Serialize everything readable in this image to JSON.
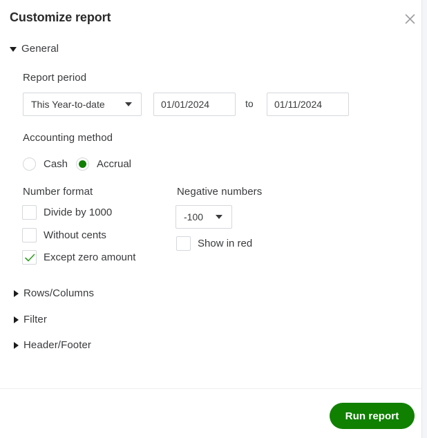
{
  "panel": {
    "title": "Customize report",
    "close_icon": "close-icon"
  },
  "sections": {
    "general": {
      "label": "General",
      "expanded": true
    },
    "rows_columns": {
      "label": "Rows/Columns",
      "expanded": false
    },
    "filter": {
      "label": "Filter",
      "expanded": false
    },
    "header_footer": {
      "label": "Header/Footer",
      "expanded": false
    }
  },
  "report_period": {
    "label": "Report period",
    "preset": "This Year-to-date",
    "separator": "to",
    "date_from": "01/01/2024",
    "date_to": "01/11/2024",
    "date_placeholder": "MM/DD/YYYY"
  },
  "accounting_method": {
    "label": "Accounting method",
    "options": [
      {
        "label": "Cash",
        "selected": false
      },
      {
        "label": "Accrual",
        "selected": true
      }
    ]
  },
  "number_format": {
    "label": "Number format",
    "options": [
      {
        "label": "Divide by 1000",
        "checked": false
      },
      {
        "label": "Without cents",
        "checked": false
      },
      {
        "label": "Except zero amount",
        "checked": true
      }
    ]
  },
  "negative_numbers": {
    "label": "Negative numbers",
    "format": "-100",
    "show_in_red": {
      "label": "Show in red",
      "checked": false
    }
  },
  "footer": {
    "run_report_label": "Run report"
  },
  "colors": {
    "accent_green": "#108000",
    "text": "#393a3d",
    "title": "#2b2b2b",
    "border": "#d4d7dc",
    "divider": "#eceef1",
    "page_background": "#f4f5f8"
  }
}
